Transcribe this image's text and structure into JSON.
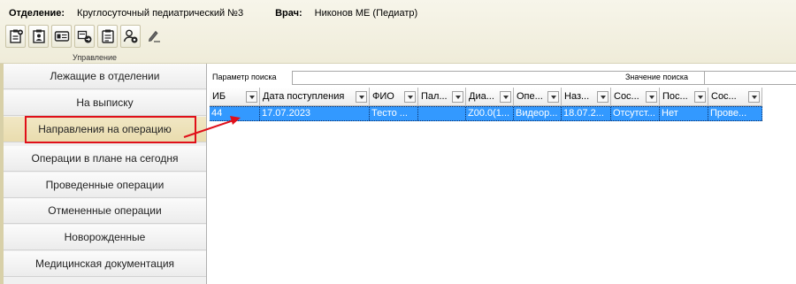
{
  "header": {
    "department_label": "Отделение:",
    "department_value": "Круглосуточный педиатрический №3",
    "doctor_label": "Врач:",
    "doctor_value": "Никонов МЕ (Педиатр)"
  },
  "ribbon": {
    "group_label": "Управление"
  },
  "nav": {
    "items": [
      {
        "label": "Лежащие в отделении"
      },
      {
        "label": "На выписку"
      },
      {
        "label": "Направления на операцию"
      },
      {
        "label": "Операции в плане на сегодня"
      },
      {
        "label": "Проведенные операции"
      },
      {
        "label": "Отмененные операции"
      },
      {
        "label": "Новорожденные"
      },
      {
        "label": "Медицинская документация"
      }
    ],
    "active_index": 2
  },
  "search": {
    "param_label": "Параметр поиска",
    "param_value": "",
    "value_label": "Значение поиска",
    "value_value": ""
  },
  "grid": {
    "columns": [
      "ИБ",
      "Дата поступления",
      "ФИО",
      "Пал...",
      "Диа...",
      "Опе...",
      "Наз...",
      "Сос...",
      "Пос...",
      "Сос..."
    ],
    "rows": [
      [
        "44",
        "17.07.2023",
        "Тесто ...",
        "",
        "Z00.0(1...",
        "Видеор...",
        "18.07.2...",
        "Отсутст...",
        "Нет",
        "Прове..."
      ]
    ]
  },
  "colors": {
    "selection": "#3399ff",
    "highlight": "#e0101a",
    "active_nav": "#ece0b4"
  }
}
